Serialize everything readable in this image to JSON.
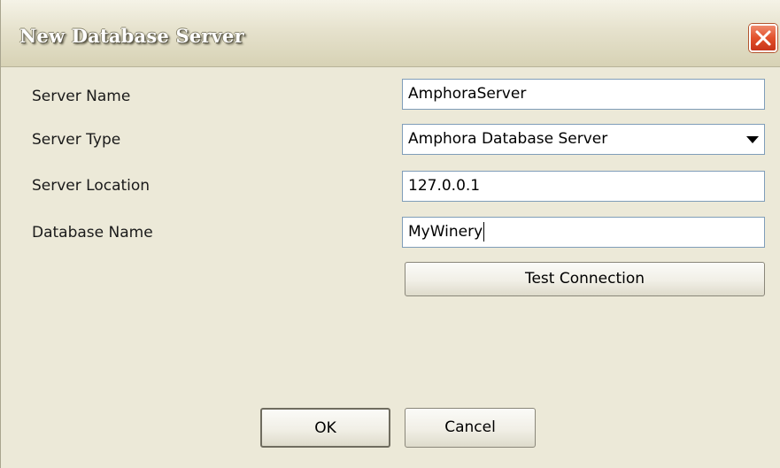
{
  "window": {
    "title": "New Database Server"
  },
  "form": {
    "server_name": {
      "label": "Server Name",
      "value": "AmphoraServer"
    },
    "server_type": {
      "label": "Server Type",
      "selected": "Amphora Database Server"
    },
    "server_location": {
      "label": "Server Location",
      "value": "127.0.0.1"
    },
    "database_name": {
      "label": "Database Name",
      "value": "MyWinery"
    }
  },
  "buttons": {
    "test_connection": "Test Connection",
    "ok": "OK",
    "cancel": "Cancel"
  },
  "icons": {
    "close": "close-icon",
    "dropdown": "chevron-down-icon"
  },
  "colors": {
    "dialog_background": "#ece9d8",
    "close_button": "#e2502b",
    "input_border": "#7f9db9"
  }
}
